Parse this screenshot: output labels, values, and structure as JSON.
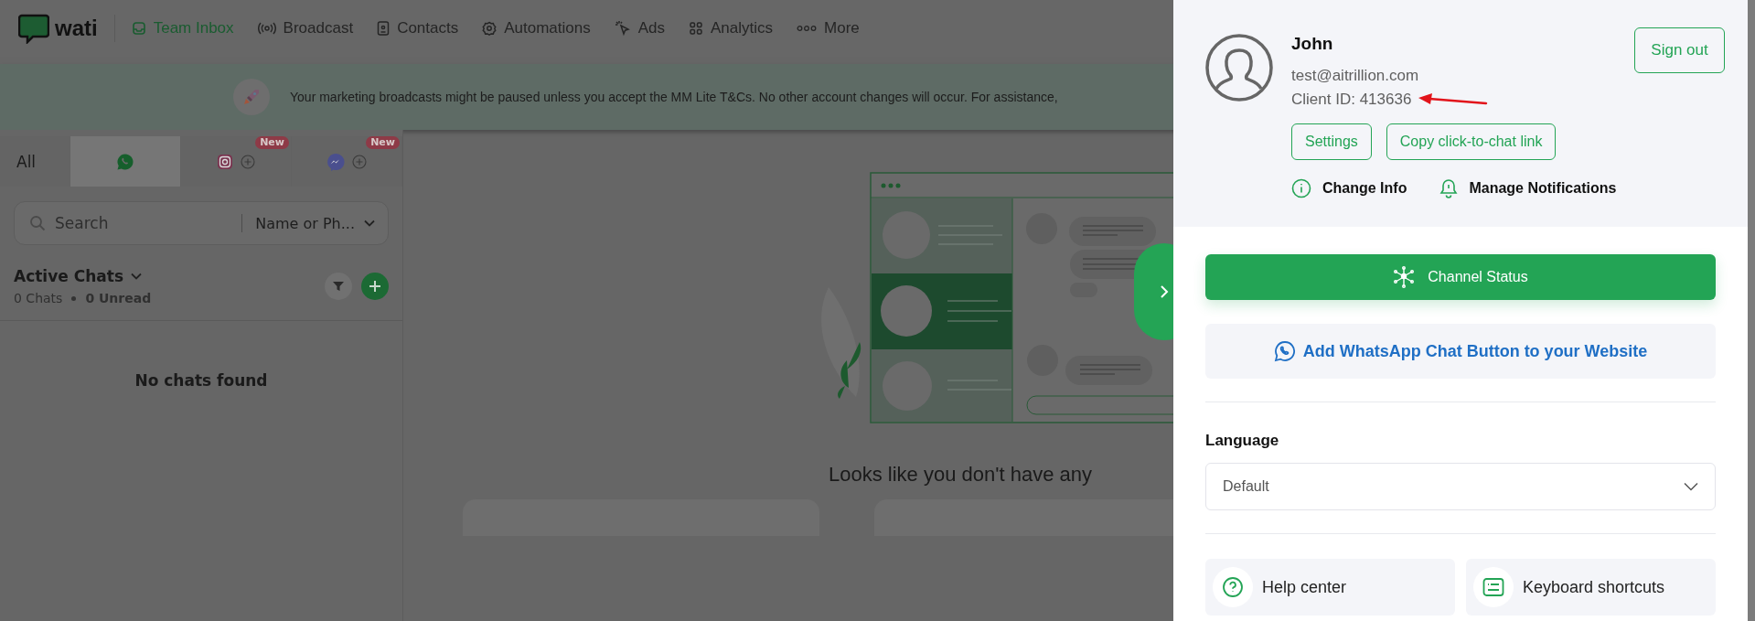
{
  "nav": {
    "logo": "wati",
    "items": [
      {
        "label": "Team Inbox",
        "kind": "inbox",
        "selected": true
      },
      {
        "label": "Broadcast",
        "kind": "broadcast",
        "selected": false
      },
      {
        "label": "Contacts",
        "kind": "contacts",
        "selected": false
      },
      {
        "label": "Automations",
        "kind": "gear",
        "selected": false
      },
      {
        "label": "Ads",
        "kind": "cursor",
        "selected": false
      },
      {
        "label": "Analytics",
        "kind": "grid",
        "selected": false
      },
      {
        "label": "More",
        "kind": "dots",
        "selected": false
      }
    ]
  },
  "banner": {
    "text": "Your marketing broadcasts might be paused unless you accept the MM Lite T&Cs. No other account changes will occur. For assistance,"
  },
  "channel_tabs": [
    {
      "kind": "text",
      "label": "All",
      "selected": false
    },
    {
      "kind": "whatsapp",
      "selected": true
    },
    {
      "kind": "instagram",
      "badge": "New",
      "selected": false
    },
    {
      "kind": "messenger",
      "badge": "New",
      "selected": false
    }
  ],
  "search": {
    "placeholder": "Search",
    "filter": "Name or Ph..."
  },
  "chats": {
    "title": "Active Chats",
    "count": "0 Chats",
    "unread": "0 Unread",
    "empty": "No chats found"
  },
  "main": {
    "headline": "Looks like you don't have any"
  },
  "profile": {
    "name": "John",
    "email": "test@aitrillion.com",
    "client_id": "Client ID: 413636",
    "sign_out": "Sign out",
    "buttons": [
      "Settings",
      "Copy click-to-chat link"
    ],
    "links": [
      {
        "label": "Change Info",
        "kind": "info"
      },
      {
        "label": "Manage Notifications",
        "kind": "bell"
      }
    ]
  },
  "channel_status": "Channel Status",
  "add_button": "Add WhatsApp Chat Button to your Website",
  "language": {
    "label": "Language",
    "value": "Default"
  },
  "shortcuts": [
    {
      "label": "Help center",
      "kind": "help"
    },
    {
      "label": "Keyboard shortcuts",
      "kind": "keyboard"
    }
  ]
}
